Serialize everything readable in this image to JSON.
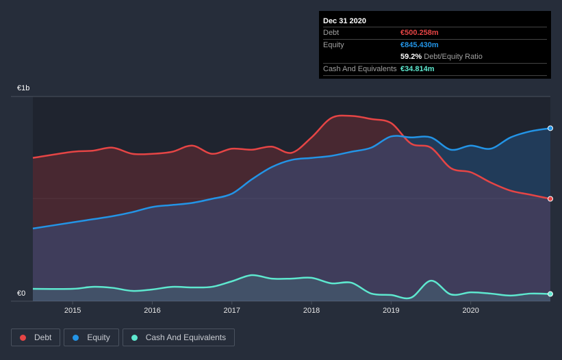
{
  "tooltip": {
    "date": "Dec 31 2020",
    "rows": [
      {
        "label": "Debt",
        "value": "€500.258m"
      },
      {
        "label": "Equity",
        "value": "€845.430m"
      },
      {
        "label": "",
        "value": "59.2%",
        "suffix": "Debt/Equity Ratio"
      },
      {
        "label": "Cash And Equivalents",
        "value": "€34.814m"
      }
    ]
  },
  "colors": {
    "debt": "#e64545",
    "equity": "#2394e6",
    "cash": "#5ee8cf"
  },
  "chart_data": {
    "type": "area",
    "title": "",
    "ylabel": "",
    "y_tick_labels": [
      "€0",
      "€1b"
    ],
    "ylim": [
      0,
      1.0
    ],
    "y_unit": "€b",
    "xlim": [
      2014.5,
      2021.0
    ],
    "x_tick_labels": [
      "2015",
      "2016",
      "2017",
      "2018",
      "2019",
      "2020"
    ],
    "x": [
      2014.5,
      2015,
      2015.25,
      2015.5,
      2015.75,
      2016,
      2016.25,
      2016.5,
      2016.75,
      2017,
      2017.25,
      2017.5,
      2017.75,
      2018,
      2018.25,
      2018.5,
      2018.75,
      2019,
      2019.25,
      2019.5,
      2019.75,
      2020,
      2020.25,
      2020.5,
      2020.75,
      2021.0
    ],
    "series": [
      {
        "name": "Debt",
        "values": [
          0.7,
          0.73,
          0.735,
          0.75,
          0.72,
          0.72,
          0.73,
          0.76,
          0.72,
          0.745,
          0.74,
          0.755,
          0.725,
          0.8,
          0.895,
          0.905,
          0.89,
          0.87,
          0.77,
          0.75,
          0.65,
          0.63,
          0.58,
          0.54,
          0.52,
          0.5
        ]
      },
      {
        "name": "Equity",
        "values": [
          0.355,
          0.385,
          0.4,
          0.415,
          0.435,
          0.46,
          0.47,
          0.48,
          0.5,
          0.525,
          0.595,
          0.655,
          0.69,
          0.7,
          0.71,
          0.73,
          0.75,
          0.805,
          0.8,
          0.8,
          0.74,
          0.76,
          0.745,
          0.8,
          0.83,
          0.845
        ]
      },
      {
        "name": "Cash And Equivalents",
        "values": [
          0.06,
          0.06,
          0.07,
          0.065,
          0.05,
          0.057,
          0.07,
          0.067,
          0.07,
          0.097,
          0.127,
          0.11,
          0.11,
          0.114,
          0.087,
          0.09,
          0.037,
          0.03,
          0.017,
          0.1,
          0.033,
          0.043,
          0.037,
          0.027,
          0.037,
          0.035
        ]
      }
    ],
    "legend": [
      "Debt",
      "Equity",
      "Cash And Equivalents"
    ],
    "legend_position": "bottom-left",
    "grid": true
  }
}
